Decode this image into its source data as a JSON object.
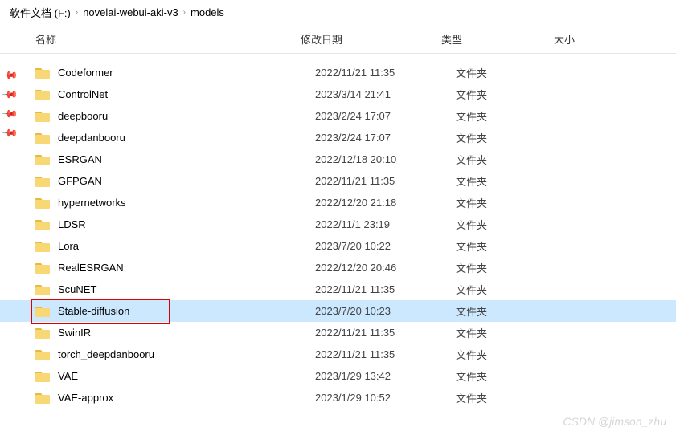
{
  "breadcrumb": {
    "root": "软件文档 (F:)",
    "path1": "novelai-webui-aki-v3",
    "path2": "models"
  },
  "columns": {
    "name": "名称",
    "date": "修改日期",
    "type": "类型",
    "size": "大小"
  },
  "folders": [
    {
      "name": "Codeformer",
      "date": "2022/11/21 11:35",
      "type": "文件夹",
      "selected": false,
      "highlighted": false
    },
    {
      "name": "ControlNet",
      "date": "2023/3/14 21:41",
      "type": "文件夹",
      "selected": false,
      "highlighted": false
    },
    {
      "name": "deepbooru",
      "date": "2023/2/24 17:07",
      "type": "文件夹",
      "selected": false,
      "highlighted": false
    },
    {
      "name": "deepdanbooru",
      "date": "2023/2/24 17:07",
      "type": "文件夹",
      "selected": false,
      "highlighted": false
    },
    {
      "name": "ESRGAN",
      "date": "2022/12/18 20:10",
      "type": "文件夹",
      "selected": false,
      "highlighted": false
    },
    {
      "name": "GFPGAN",
      "date": "2022/11/21 11:35",
      "type": "文件夹",
      "selected": false,
      "highlighted": false
    },
    {
      "name": "hypernetworks",
      "date": "2022/12/20 21:18",
      "type": "文件夹",
      "selected": false,
      "highlighted": false
    },
    {
      "name": "LDSR",
      "date": "2022/11/1 23:19",
      "type": "文件夹",
      "selected": false,
      "highlighted": false
    },
    {
      "name": "Lora",
      "date": "2023/7/20 10:22",
      "type": "文件夹",
      "selected": false,
      "highlighted": false
    },
    {
      "name": "RealESRGAN",
      "date": "2022/12/20 20:46",
      "type": "文件夹",
      "selected": false,
      "highlighted": false
    },
    {
      "name": "ScuNET",
      "date": "2022/11/21 11:35",
      "type": "文件夹",
      "selected": false,
      "highlighted": false
    },
    {
      "name": "Stable-diffusion",
      "date": "2023/7/20 10:23",
      "type": "文件夹",
      "selected": true,
      "highlighted": true
    },
    {
      "name": "SwinIR",
      "date": "2022/11/21 11:35",
      "type": "文件夹",
      "selected": false,
      "highlighted": false
    },
    {
      "name": "torch_deepdanbooru",
      "date": "2022/11/21 11:35",
      "type": "文件夹",
      "selected": false,
      "highlighted": false
    },
    {
      "name": "VAE",
      "date": "2023/1/29 13:42",
      "type": "文件夹",
      "selected": false,
      "highlighted": false
    },
    {
      "name": "VAE-approx",
      "date": "2023/1/29 10:52",
      "type": "文件夹",
      "selected": false,
      "highlighted": false
    }
  ],
  "watermark": "CSDN @jimson_zhu"
}
